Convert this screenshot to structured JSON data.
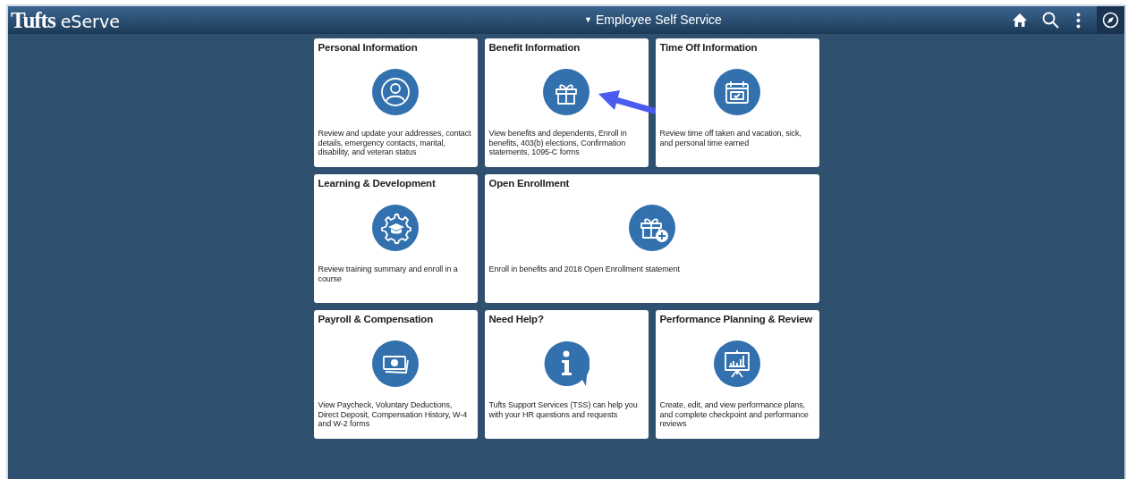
{
  "header": {
    "logo_bold": "Tufts",
    "logo_light": "eServe",
    "dropdown_glyph": "▼",
    "title": "Employee Self Service"
  },
  "tiles": [
    {
      "kind": "normal",
      "title": "Personal Information",
      "description": "Review and update your addresses, contact details, emergency contacts, marital, disability, and veteran status"
    },
    {
      "kind": "normal",
      "title": "Benefit Information",
      "description": "View benefits and dependents, Enroll in benefits, 403(b) elections, Confirmation statements, 1095-C forms"
    },
    {
      "kind": "normal",
      "title": "Time Off Information",
      "description": "Review time off taken and vacation, sick, and personal time earned"
    },
    {
      "kind": "normal",
      "title": "Learning & Development",
      "description": "Review training summary and enroll in a course"
    },
    {
      "kind": "wide",
      "title": "Open Enrollment",
      "description": "Enroll in benefits and 2018 Open Enrollment statement"
    },
    {
      "kind": "normal",
      "title": "Payroll & Compensation",
      "description": "View Paycheck, Voluntary Deductions, Direct Deposit, Compensation History, W-4 and W-2 forms"
    },
    {
      "kind": "normal",
      "title": "Need Help?",
      "description": "Tufts Support Services (TSS) can help you with your HR questions and requests"
    },
    {
      "kind": "normal",
      "title": "Performance Planning & Review",
      "description": "Create, edit, and view performance plans, and complete checkpoint and performance reviews"
    }
  ]
}
